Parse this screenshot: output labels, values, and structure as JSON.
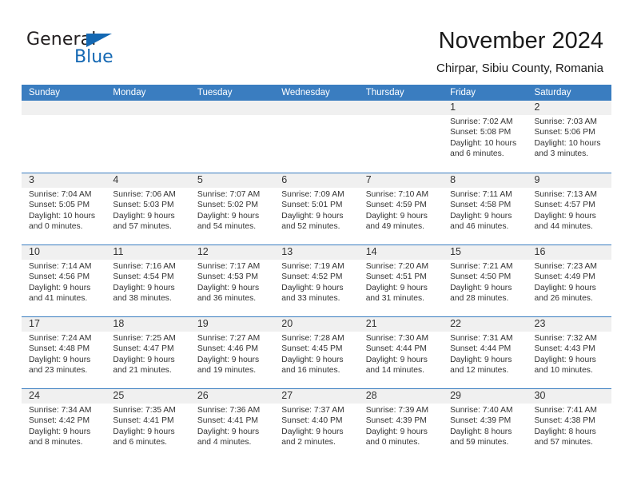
{
  "brand": {
    "name_part1": "General",
    "name_part2": "Blue",
    "accent_color": "#1468b3"
  },
  "header": {
    "title": "November 2024",
    "location": "Chirpar, Sibiu County, Romania"
  },
  "calendar": {
    "header_color": "#3a7dc0",
    "daynum_band_color": "#f0f0f0",
    "weekdays": [
      "Sunday",
      "Monday",
      "Tuesday",
      "Wednesday",
      "Thursday",
      "Friday",
      "Saturday"
    ],
    "weeks": [
      [
        {
          "day": "",
          "sunrise": "",
          "sunset": "",
          "daylight_line1": "",
          "daylight_line2": ""
        },
        {
          "day": "",
          "sunrise": "",
          "sunset": "",
          "daylight_line1": "",
          "daylight_line2": ""
        },
        {
          "day": "",
          "sunrise": "",
          "sunset": "",
          "daylight_line1": "",
          "daylight_line2": ""
        },
        {
          "day": "",
          "sunrise": "",
          "sunset": "",
          "daylight_line1": "",
          "daylight_line2": ""
        },
        {
          "day": "",
          "sunrise": "",
          "sunset": "",
          "daylight_line1": "",
          "daylight_line2": ""
        },
        {
          "day": "1",
          "sunrise": "Sunrise: 7:02 AM",
          "sunset": "Sunset: 5:08 PM",
          "daylight_line1": "Daylight: 10 hours",
          "daylight_line2": "and 6 minutes."
        },
        {
          "day": "2",
          "sunrise": "Sunrise: 7:03 AM",
          "sunset": "Sunset: 5:06 PM",
          "daylight_line1": "Daylight: 10 hours",
          "daylight_line2": "and 3 minutes."
        }
      ],
      [
        {
          "day": "3",
          "sunrise": "Sunrise: 7:04 AM",
          "sunset": "Sunset: 5:05 PM",
          "daylight_line1": "Daylight: 10 hours",
          "daylight_line2": "and 0 minutes."
        },
        {
          "day": "4",
          "sunrise": "Sunrise: 7:06 AM",
          "sunset": "Sunset: 5:03 PM",
          "daylight_line1": "Daylight: 9 hours",
          "daylight_line2": "and 57 minutes."
        },
        {
          "day": "5",
          "sunrise": "Sunrise: 7:07 AM",
          "sunset": "Sunset: 5:02 PM",
          "daylight_line1": "Daylight: 9 hours",
          "daylight_line2": "and 54 minutes."
        },
        {
          "day": "6",
          "sunrise": "Sunrise: 7:09 AM",
          "sunset": "Sunset: 5:01 PM",
          "daylight_line1": "Daylight: 9 hours",
          "daylight_line2": "and 52 minutes."
        },
        {
          "day": "7",
          "sunrise": "Sunrise: 7:10 AM",
          "sunset": "Sunset: 4:59 PM",
          "daylight_line1": "Daylight: 9 hours",
          "daylight_line2": "and 49 minutes."
        },
        {
          "day": "8",
          "sunrise": "Sunrise: 7:11 AM",
          "sunset": "Sunset: 4:58 PM",
          "daylight_line1": "Daylight: 9 hours",
          "daylight_line2": "and 46 minutes."
        },
        {
          "day": "9",
          "sunrise": "Sunrise: 7:13 AM",
          "sunset": "Sunset: 4:57 PM",
          "daylight_line1": "Daylight: 9 hours",
          "daylight_line2": "and 44 minutes."
        }
      ],
      [
        {
          "day": "10",
          "sunrise": "Sunrise: 7:14 AM",
          "sunset": "Sunset: 4:56 PM",
          "daylight_line1": "Daylight: 9 hours",
          "daylight_line2": "and 41 minutes."
        },
        {
          "day": "11",
          "sunrise": "Sunrise: 7:16 AM",
          "sunset": "Sunset: 4:54 PM",
          "daylight_line1": "Daylight: 9 hours",
          "daylight_line2": "and 38 minutes."
        },
        {
          "day": "12",
          "sunrise": "Sunrise: 7:17 AM",
          "sunset": "Sunset: 4:53 PM",
          "daylight_line1": "Daylight: 9 hours",
          "daylight_line2": "and 36 minutes."
        },
        {
          "day": "13",
          "sunrise": "Sunrise: 7:19 AM",
          "sunset": "Sunset: 4:52 PM",
          "daylight_line1": "Daylight: 9 hours",
          "daylight_line2": "and 33 minutes."
        },
        {
          "day": "14",
          "sunrise": "Sunrise: 7:20 AM",
          "sunset": "Sunset: 4:51 PM",
          "daylight_line1": "Daylight: 9 hours",
          "daylight_line2": "and 31 minutes."
        },
        {
          "day": "15",
          "sunrise": "Sunrise: 7:21 AM",
          "sunset": "Sunset: 4:50 PM",
          "daylight_line1": "Daylight: 9 hours",
          "daylight_line2": "and 28 minutes."
        },
        {
          "day": "16",
          "sunrise": "Sunrise: 7:23 AM",
          "sunset": "Sunset: 4:49 PM",
          "daylight_line1": "Daylight: 9 hours",
          "daylight_line2": "and 26 minutes."
        }
      ],
      [
        {
          "day": "17",
          "sunrise": "Sunrise: 7:24 AM",
          "sunset": "Sunset: 4:48 PM",
          "daylight_line1": "Daylight: 9 hours",
          "daylight_line2": "and 23 minutes."
        },
        {
          "day": "18",
          "sunrise": "Sunrise: 7:25 AM",
          "sunset": "Sunset: 4:47 PM",
          "daylight_line1": "Daylight: 9 hours",
          "daylight_line2": "and 21 minutes."
        },
        {
          "day": "19",
          "sunrise": "Sunrise: 7:27 AM",
          "sunset": "Sunset: 4:46 PM",
          "daylight_line1": "Daylight: 9 hours",
          "daylight_line2": "and 19 minutes."
        },
        {
          "day": "20",
          "sunrise": "Sunrise: 7:28 AM",
          "sunset": "Sunset: 4:45 PM",
          "daylight_line1": "Daylight: 9 hours",
          "daylight_line2": "and 16 minutes."
        },
        {
          "day": "21",
          "sunrise": "Sunrise: 7:30 AM",
          "sunset": "Sunset: 4:44 PM",
          "daylight_line1": "Daylight: 9 hours",
          "daylight_line2": "and 14 minutes."
        },
        {
          "day": "22",
          "sunrise": "Sunrise: 7:31 AM",
          "sunset": "Sunset: 4:44 PM",
          "daylight_line1": "Daylight: 9 hours",
          "daylight_line2": "and 12 minutes."
        },
        {
          "day": "23",
          "sunrise": "Sunrise: 7:32 AM",
          "sunset": "Sunset: 4:43 PM",
          "daylight_line1": "Daylight: 9 hours",
          "daylight_line2": "and 10 minutes."
        }
      ],
      [
        {
          "day": "24",
          "sunrise": "Sunrise: 7:34 AM",
          "sunset": "Sunset: 4:42 PM",
          "daylight_line1": "Daylight: 9 hours",
          "daylight_line2": "and 8 minutes."
        },
        {
          "day": "25",
          "sunrise": "Sunrise: 7:35 AM",
          "sunset": "Sunset: 4:41 PM",
          "daylight_line1": "Daylight: 9 hours",
          "daylight_line2": "and 6 minutes."
        },
        {
          "day": "26",
          "sunrise": "Sunrise: 7:36 AM",
          "sunset": "Sunset: 4:41 PM",
          "daylight_line1": "Daylight: 9 hours",
          "daylight_line2": "and 4 minutes."
        },
        {
          "day": "27",
          "sunrise": "Sunrise: 7:37 AM",
          "sunset": "Sunset: 4:40 PM",
          "daylight_line1": "Daylight: 9 hours",
          "daylight_line2": "and 2 minutes."
        },
        {
          "day": "28",
          "sunrise": "Sunrise: 7:39 AM",
          "sunset": "Sunset: 4:39 PM",
          "daylight_line1": "Daylight: 9 hours",
          "daylight_line2": "and 0 minutes."
        },
        {
          "day": "29",
          "sunrise": "Sunrise: 7:40 AM",
          "sunset": "Sunset: 4:39 PM",
          "daylight_line1": "Daylight: 8 hours",
          "daylight_line2": "and 59 minutes."
        },
        {
          "day": "30",
          "sunrise": "Sunrise: 7:41 AM",
          "sunset": "Sunset: 4:38 PM",
          "daylight_line1": "Daylight: 8 hours",
          "daylight_line2": "and 57 minutes."
        }
      ]
    ]
  }
}
